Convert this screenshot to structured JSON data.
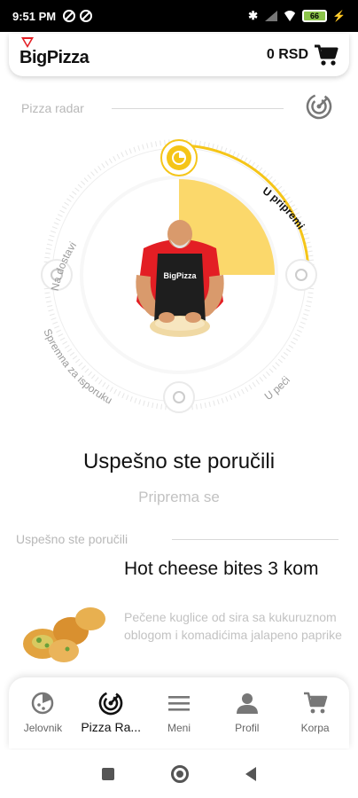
{
  "status_bar": {
    "time": "9:51 PM",
    "battery": "66"
  },
  "header": {
    "logo_text": "BigPizza",
    "cart_amount": "0 RSD",
    "cart_icon": "cart-icon"
  },
  "radar": {
    "title": "Pizza radar",
    "stages": [
      "Na dostavi",
      "U pripremi",
      "U peći",
      "Spremna za isporuku"
    ],
    "active_stage": "U pripremi",
    "progress_fraction": 0.25,
    "accent_color": "#f5c518"
  },
  "status": {
    "title": "Uspešno ste poručili",
    "subtitle": "Priprema se"
  },
  "order": {
    "section_title": "Uspešno ste poručili",
    "item_name": "Hot cheese bites 3 kom",
    "item_desc": "Pečene kuglice od sira sa kukuruznom oblogom i komadićima jalapeno paprike"
  },
  "bottom_nav": [
    {
      "label": "Jelovnik",
      "icon": "pizza-icon"
    },
    {
      "label": "Pizza Ra...",
      "icon": "radar-icon"
    },
    {
      "label": "Meni",
      "icon": "menu-icon"
    },
    {
      "label": "Profil",
      "icon": "person-icon"
    },
    {
      "label": "Korpa",
      "icon": "cart-icon"
    }
  ]
}
